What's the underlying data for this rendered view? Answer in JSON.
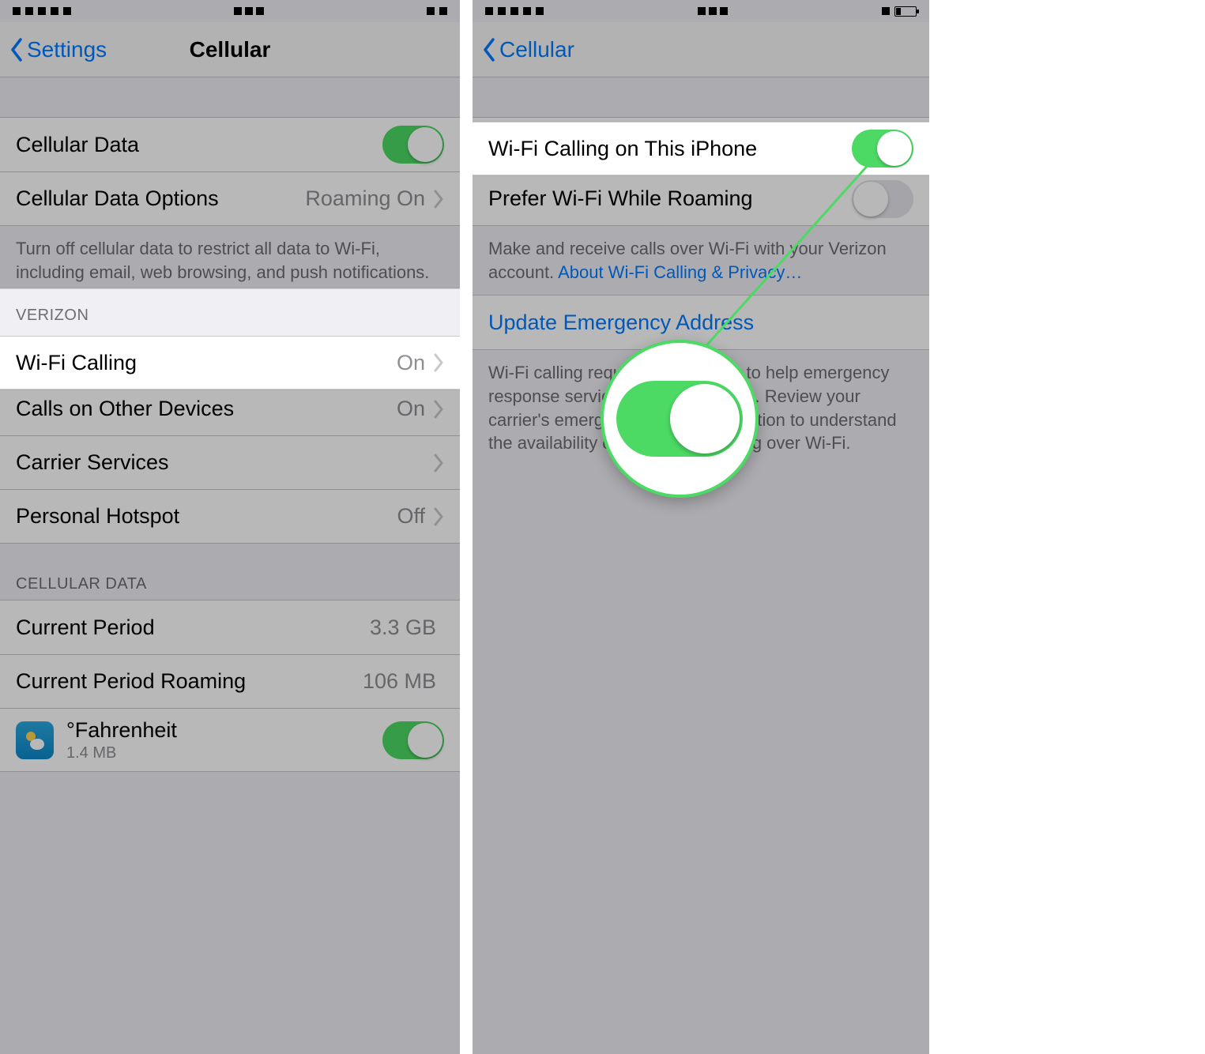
{
  "left": {
    "nav": {
      "back": "Settings",
      "title": "Cellular"
    },
    "cellular_data": {
      "label": "Cellular Data",
      "on": true
    },
    "cellular_data_options": {
      "label": "Cellular Data Options",
      "value": "Roaming On"
    },
    "footer1": "Turn off cellular data to restrict all data to Wi-Fi, including email, web browsing, and push notifications.",
    "section_verizon": "VERIZON",
    "wifi_calling": {
      "label": "Wi-Fi Calling",
      "value": "On"
    },
    "calls_other": {
      "label": "Calls on Other Devices",
      "value": "On"
    },
    "carrier_services": {
      "label": "Carrier Services"
    },
    "personal_hotspot": {
      "label": "Personal Hotspot",
      "value": "Off"
    },
    "section_data": "CELLULAR DATA",
    "current_period": {
      "label": "Current Period",
      "value": "3.3 GB"
    },
    "current_period_roaming": {
      "label": "Current Period Roaming",
      "value": "106 MB"
    },
    "app_fahrenheit": {
      "name": "°Fahrenheit",
      "size": "1.4 MB",
      "on": true
    }
  },
  "right": {
    "nav": {
      "back": "Cellular",
      "title": ""
    },
    "wifi_on_iphone": {
      "label": "Wi-Fi Calling on This iPhone",
      "on": true
    },
    "prefer_roaming": {
      "label": "Prefer Wi-Fi While Roaming",
      "on": false
    },
    "footer1_pre": "Make and receive calls over Wi-Fi with your Verizon account. ",
    "footer1_link": "About Wi-Fi Calling & Privacy…",
    "update_emergency": "Update Emergency Address",
    "footer2": "Wi-Fi calling requires an address to help emergency response services respond to calls. Review your carrier's emergency calling information to understand the availability of emergency calling over Wi-Fi."
  },
  "colors": {
    "link": "#007aff",
    "toggle_on": "#4cd964"
  }
}
